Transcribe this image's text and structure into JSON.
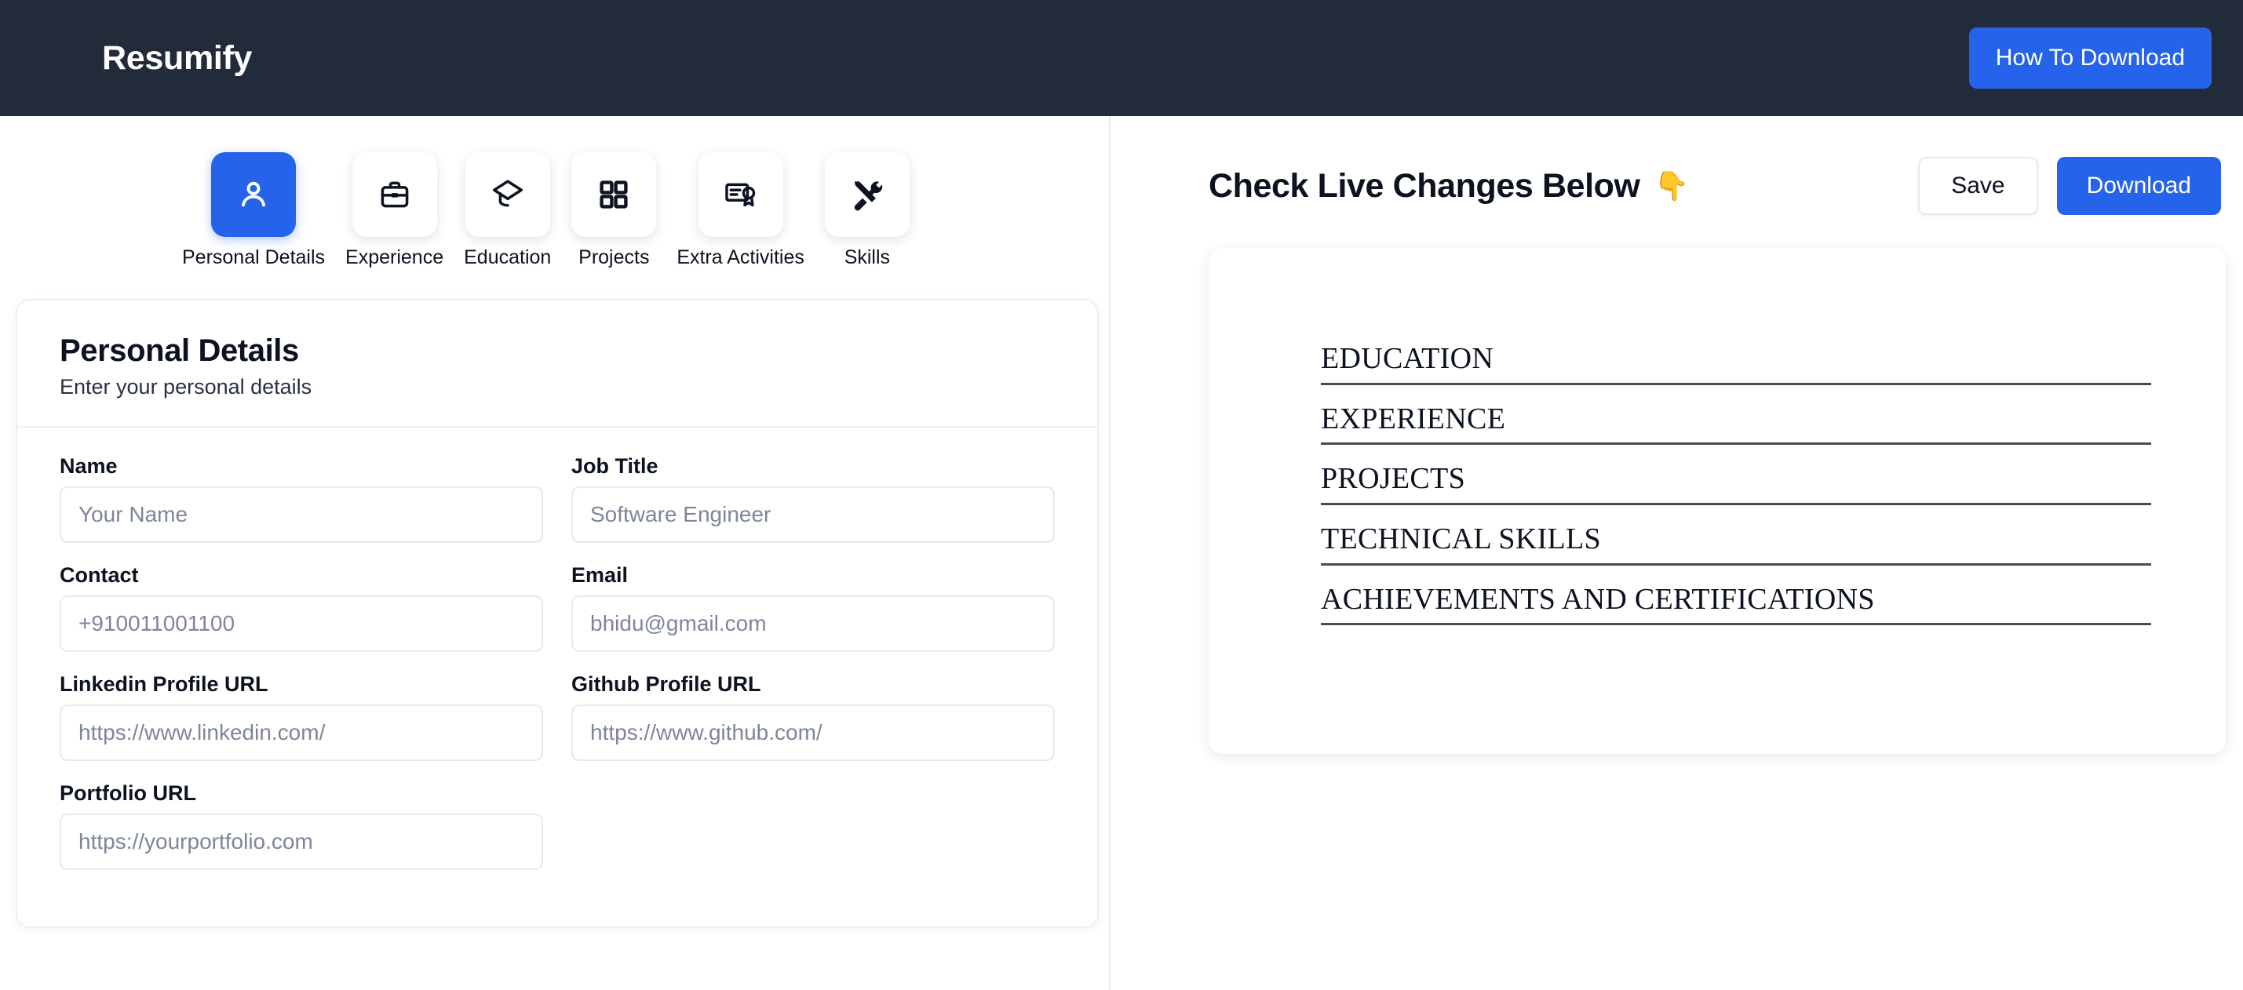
{
  "header": {
    "brand": "Resumify",
    "how_to_download_label": "How To Download"
  },
  "tabs": [
    {
      "label": "Personal Details",
      "icon": "person-icon",
      "active": true
    },
    {
      "label": "Experience",
      "icon": "briefcase-icon",
      "active": false
    },
    {
      "label": "Education",
      "icon": "graduation-cap-icon",
      "active": false
    },
    {
      "label": "Projects",
      "icon": "grid-icon",
      "active": false
    },
    {
      "label": "Extra Activities",
      "icon": "certificate-icon",
      "active": false
    },
    {
      "label": "Skills",
      "icon": "tools-icon",
      "active": false
    }
  ],
  "form": {
    "title": "Personal Details",
    "subtitle": "Enter your personal details",
    "fields": [
      {
        "label": "Name",
        "placeholder": "Your Name",
        "value": ""
      },
      {
        "label": "Job Title",
        "placeholder": "Software Engineer",
        "value": ""
      },
      {
        "label": "Contact",
        "placeholder": "+910011001100",
        "value": ""
      },
      {
        "label": "Email",
        "placeholder": "bhidu@gmail.com",
        "value": ""
      },
      {
        "label": "Linkedin Profile URL",
        "placeholder": "https://www.linkedin.com/",
        "value": ""
      },
      {
        "label": "Github Profile URL",
        "placeholder": "https://www.github.com/",
        "value": ""
      },
      {
        "label": "Portfolio URL",
        "placeholder": "https://yourportfolio.com",
        "value": ""
      }
    ]
  },
  "preview": {
    "title": "Check Live Changes Below",
    "emoji": "👇",
    "save_label": "Save",
    "download_label": "Download",
    "sections": [
      "EDUCATION",
      "EXPERIENCE",
      "PROJECTS",
      "TECHNICAL SKILLS",
      "ACHIEVEMENTS AND CERTIFICATIONS"
    ]
  },
  "colors": {
    "header_bg": "#222b3a",
    "accent_blue": "#2563eb",
    "text_dark": "#0d1220",
    "border_light": "#e4e9f2",
    "rule_dark": "#4a4a52"
  }
}
